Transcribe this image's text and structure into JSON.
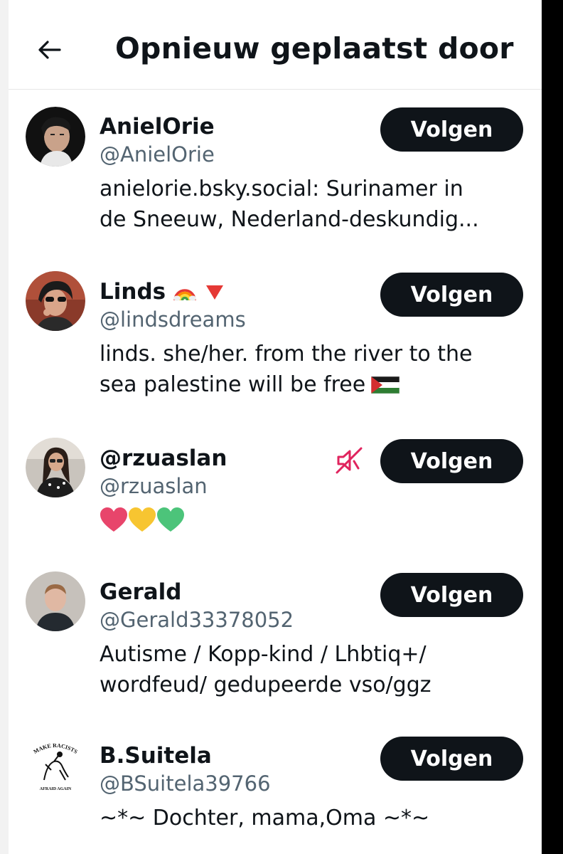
{
  "header": {
    "title": "Opnieuw geplaatst door"
  },
  "users": [
    {
      "name": "AnielOrie",
      "handle": "@AnielOrie",
      "bio_line1": "anielorie.bsky.social: Surinamer in",
      "bio_line2": "de Sneeuw,  Nederland-deskundig...",
      "follow_label": "Volgen"
    },
    {
      "name": "Linds",
      "handle": "@lindsdreams",
      "bio_line1": "linds. she/her. from the river to the",
      "bio_line2": "sea palestine will be free",
      "follow_label": "Volgen"
    },
    {
      "name": "@rzuaslan",
      "handle": "@rzuaslan",
      "bio_line1": "",
      "bio_line2": "",
      "follow_label": "Volgen"
    },
    {
      "name": "Gerald",
      "handle": "@Gerald33378052",
      "bio_line1": "Autisme / Kopp-kind / Lhbtiq+/",
      "bio_line2": "wordfeud/ gedupeerde vso/ggz",
      "follow_label": "Volgen"
    },
    {
      "name": "B.Suitela",
      "handle": "@BSuitela39766",
      "bio_line1": "~*~ Dochter, mama,Oma ~*~",
      "bio_line2": "",
      "follow_label": "Volgen"
    }
  ],
  "avatar5_text": {
    "top": "MAKE RACISTS",
    "bottom": "AFRAID AGAIN"
  },
  "colors": {
    "button_bg": "#0f1419",
    "secondary_text": "#536471",
    "mute_icon": "#e0245e"
  },
  "icons": [
    "back-arrow-icon",
    "rainbow-icon",
    "red-triangle-icon",
    "palestine-flag-icon",
    "muted-icon",
    "heart-pink-icon",
    "heart-yellow-icon",
    "heart-green-icon"
  ]
}
